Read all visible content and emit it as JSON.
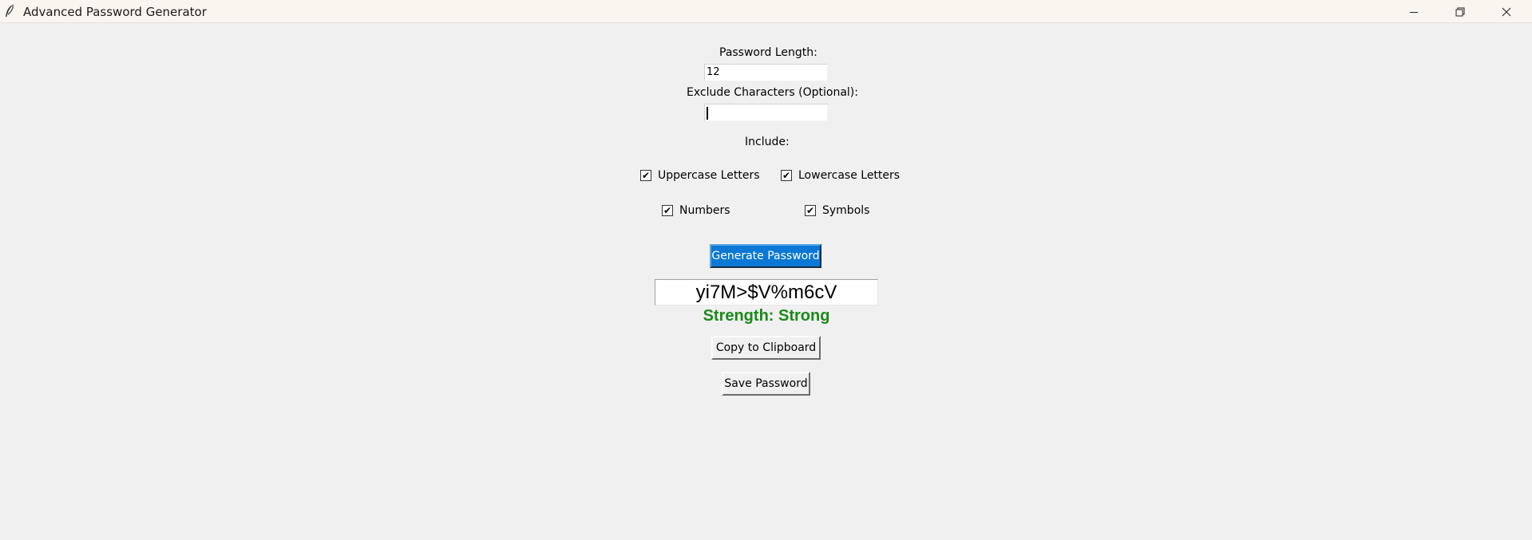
{
  "window": {
    "title": "Advanced Password Generator",
    "icon": "feather-icon",
    "controls": [
      "minimize-icon",
      "restore-icon",
      "close-icon"
    ]
  },
  "form": {
    "length_label": "Password Length:",
    "length_value": "12",
    "exclude_label": "Exclude Characters (Optional):",
    "exclude_value": "",
    "include_label": "Include:"
  },
  "options": {
    "uppercase": {
      "label": "Uppercase Letters",
      "checked": true
    },
    "lowercase": {
      "label": "Lowercase Letters",
      "checked": true
    },
    "numbers": {
      "label": "Numbers",
      "checked": true
    },
    "symbols": {
      "label": "Symbols",
      "checked": true
    },
    "check_mark": "✔"
  },
  "actions": {
    "generate_label": "Generate Password",
    "copy_label": "Copy to Clipboard",
    "save_label": "Save Password"
  },
  "result": {
    "password": "yi7M>$V%m6cV",
    "strength_text": "Strength: Strong",
    "strength_color": "#1a8a1a"
  },
  "colors": {
    "primary_button": "#0a78d4",
    "background": "#f0f0f0",
    "titlebar": "#fbf5ef"
  }
}
